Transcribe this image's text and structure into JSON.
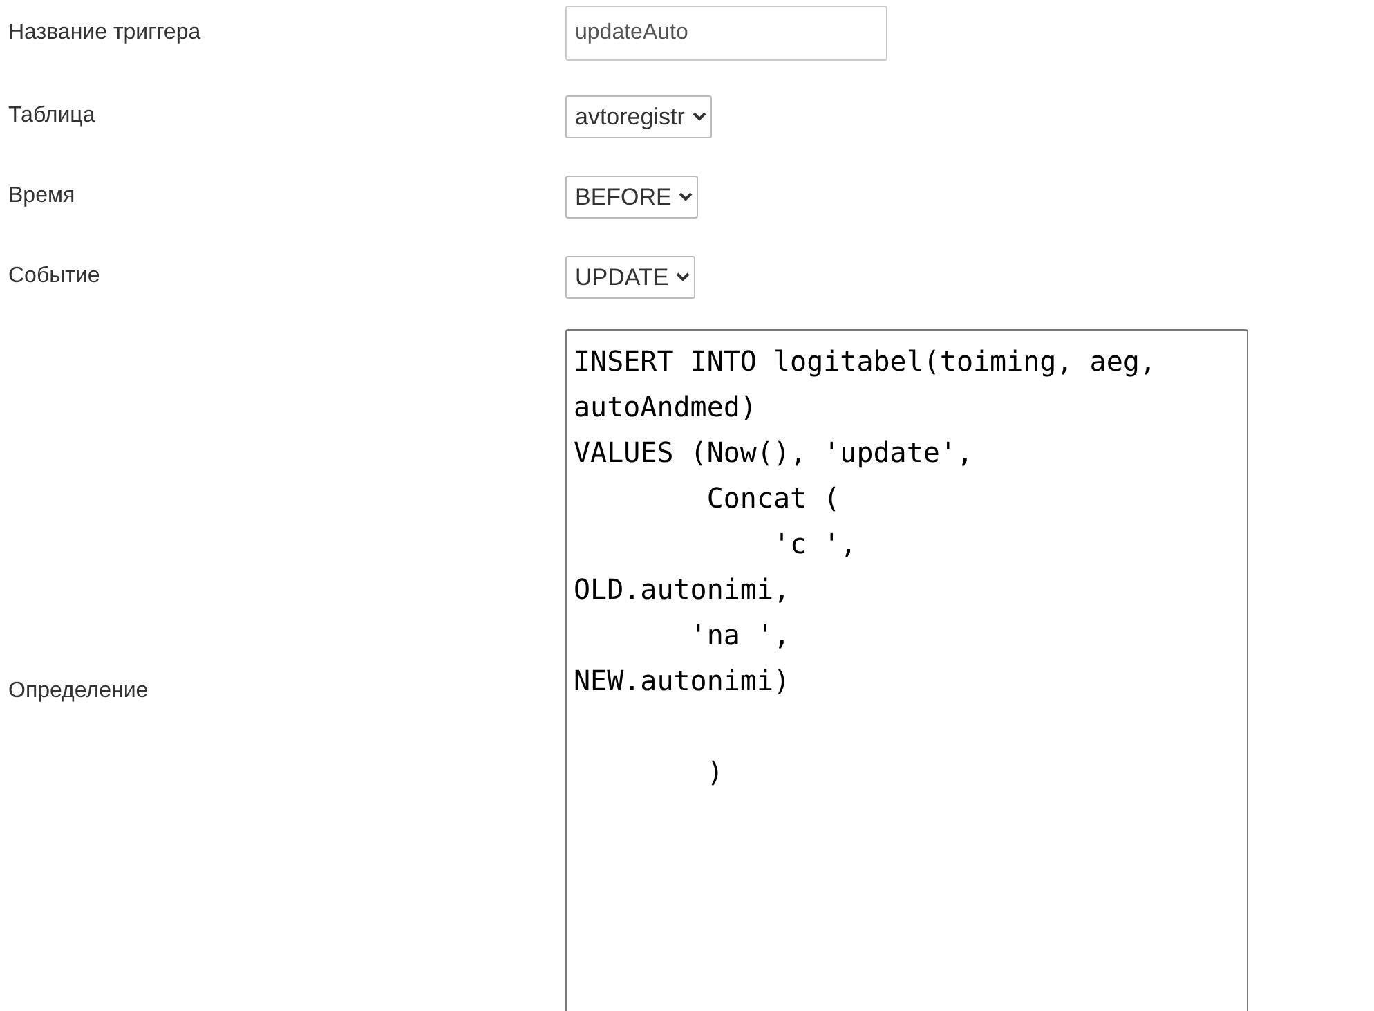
{
  "fields": [
    {
      "kind": "text",
      "label": "Название триггера",
      "value": "updateAuto"
    },
    {
      "kind": "select",
      "label": "Таблица",
      "value": "avtoregistr"
    },
    {
      "kind": "select",
      "label": "Время",
      "value": "BEFORE"
    },
    {
      "kind": "select",
      "label": "Событие",
      "value": "UPDATE"
    },
    {
      "kind": "textarea",
      "label": "Определение",
      "value": "INSERT INTO logitabel(toiming, aeg,\nautoAndmed)\nVALUES (Now(), 'update',\n        Concat (\n            'c ',\nOLD.autonimi,\n       'na ',\nNEW.autonimi)\n\n        )"
    }
  ]
}
